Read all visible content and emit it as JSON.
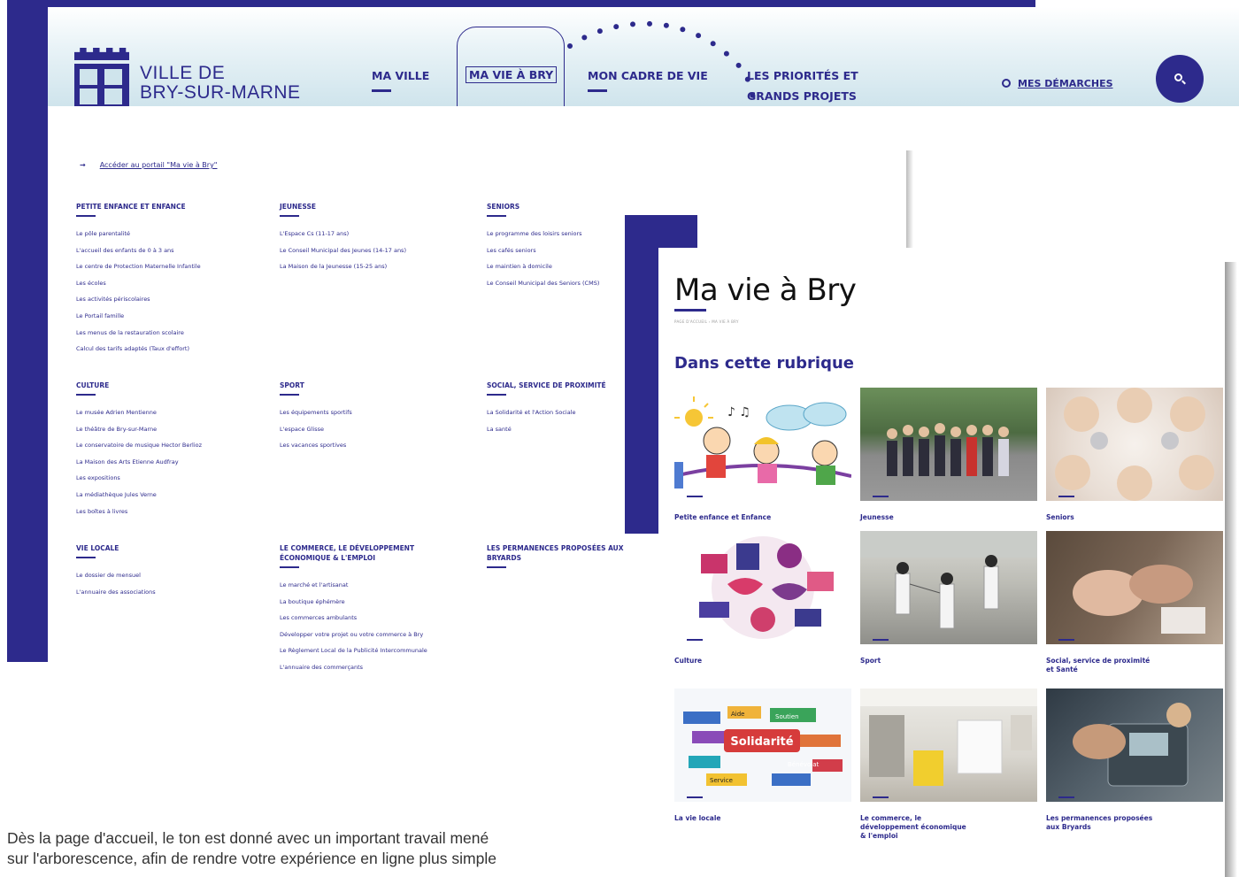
{
  "header": {
    "logo_line1": "VILLE DE",
    "logo_line2": "BRY-SUR-MARNE",
    "nav": [
      {
        "label": "MA VILLE"
      },
      {
        "label": "MA VIE À BRY"
      },
      {
        "label": "MON CADRE DE VIE"
      },
      {
        "label": "LES PRIORITÉS ET"
      },
      {
        "label": "GRANDS PROJETS"
      }
    ],
    "demarches_label": "MES DÉMARCHES"
  },
  "menu": {
    "portal_link": "Accéder au portail \"Ma vie à Bry\"",
    "columns": [
      {
        "title": "PETITE ENFANCE ET ENFANCE",
        "items": [
          "Le pôle parentalité",
          "L'accueil des enfants de 0 à 3 ans",
          "Le centre de Protection Maternelle Infantile",
          "Les écoles",
          "Les activités périscolaires",
          "Le Portail famille",
          "Les menus de la restauration scolaire",
          "Calcul des tarifs adaptés (Taux d'effort)"
        ]
      },
      {
        "title": "JEUNESSE",
        "items": [
          "L'Espace Cs (11-17 ans)",
          "Le Conseil Municipal des Jeunes (14-17 ans)",
          "La Maison de la Jeunesse (15-25 ans)"
        ]
      },
      {
        "title": "SENIORS",
        "items": [
          "Le programme des loisirs seniors",
          "Les cafés seniors",
          "Le maintien à domicile",
          "Le Conseil Municipal des Seniors (CMS)"
        ]
      },
      {
        "title": "CULTURE",
        "items": [
          "Le musée Adrien Mentienne",
          "Le théâtre de Bry-sur-Marne",
          "Le conservatoire de musique Hector Berlioz",
          "La Maison des Arts Etienne Audfray",
          "Les expositions",
          "La médiathèque Jules Verne",
          "Les boîtes à livres"
        ]
      },
      {
        "title": "SPORT",
        "items": [
          "Les équipements sportifs",
          "L'espace Glisse",
          "Les vacances sportives"
        ]
      },
      {
        "title": "SOCIAL, SERVICE DE PROXIMITÉ",
        "items": [
          "La Solidarité et l'Action Sociale",
          "La santé"
        ]
      },
      {
        "title": "VIE LOCALE",
        "items": [
          "Le dossier de mensuel",
          "L'annuaire des associations"
        ]
      },
      {
        "title_line1": "LE COMMERCE, LE DÉVELOPPEMENT",
        "title_line2": "ÉCONOMIQUE & L'EMPLOI",
        "items": [
          "Le marché et l'artisanat",
          "La boutique éphémère",
          "Les commerces ambulants",
          "Développer votre projet ou votre commerce à Bry",
          "Le Règlement Local de la Publicité Intercommunale",
          "L'annuaire des commerçants"
        ]
      },
      {
        "title_line1": "LES PERMANENCES PROPOSÉES AUX",
        "title_line2": "BRYARDS",
        "items": []
      }
    ]
  },
  "page": {
    "title": "Ma vie à Bry",
    "breadcrumb": "PAGE D'ACCUEIL › MA VIE À BRY",
    "section_title": "Dans cette rubrique",
    "tiles": [
      {
        "label": "Petite enfance et Enfance"
      },
      {
        "label": "Jeunesse"
      },
      {
        "label": "Seniors"
      },
      {
        "label": "Culture"
      },
      {
        "label": "Sport"
      },
      {
        "label_line1": "Social, service de proximité",
        "label_line2": "et Santé"
      },
      {
        "label": "La vie locale"
      },
      {
        "label_line1": "Le commerce, le",
        "label_line2": "développement économique",
        "label_line3": "& l'emploi"
      },
      {
        "label_line1": "Les permanences proposées",
        "label_line2": "aux Bryards"
      }
    ],
    "solidarity_words": [
      "Solidarité",
      "Bénévolat",
      "Service",
      "Soutien",
      "Aide"
    ]
  },
  "intro": {
    "line1": "Dès la page d'accueil, le ton est donné avec un important travail mené",
    "line2": "sur l'arborescence, afin de rendre votre expérience en ligne plus simple"
  },
  "colors": {
    "brand": "#2d2a8c"
  }
}
